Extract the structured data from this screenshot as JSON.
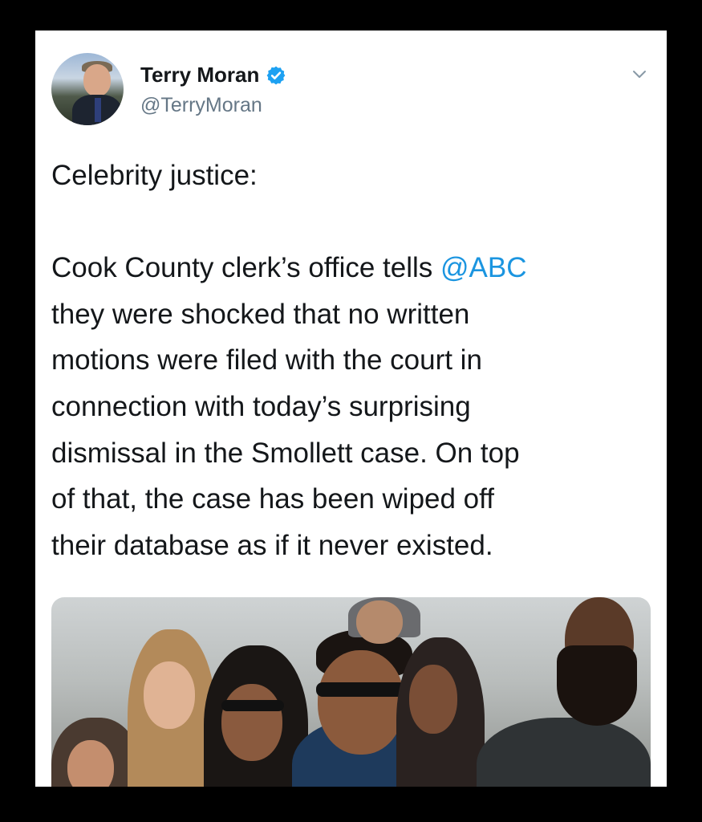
{
  "tweet": {
    "author_name": "Terry Moran",
    "handle": "@TerryMoran",
    "verified": true,
    "text_lines": [
      {
        "text": "Celebrity justice:"
      },
      {
        "text": ""
      },
      {
        "before": "Cook County clerk’s office tells ",
        "mention": "@ABC"
      },
      {
        "text": "they were shocked that no written"
      },
      {
        "text": "motions were filed with the court in"
      },
      {
        "text": "connection with today’s surprising"
      },
      {
        "text": "dismissal in the Smollett case. On top"
      },
      {
        "text": "of that, the case has been wiped off"
      },
      {
        "text": "their database as if it never existed."
      }
    ],
    "media": {
      "kind": "photo"
    }
  },
  "colors": {
    "background": "#000000",
    "card": "#ffffff",
    "text": "#14171a",
    "secondary": "#657786",
    "link": "#1b95e0",
    "verified": "#1da1f2"
  },
  "icons": {
    "verified": "verified-badge-icon",
    "more": "chevron-down-icon"
  }
}
